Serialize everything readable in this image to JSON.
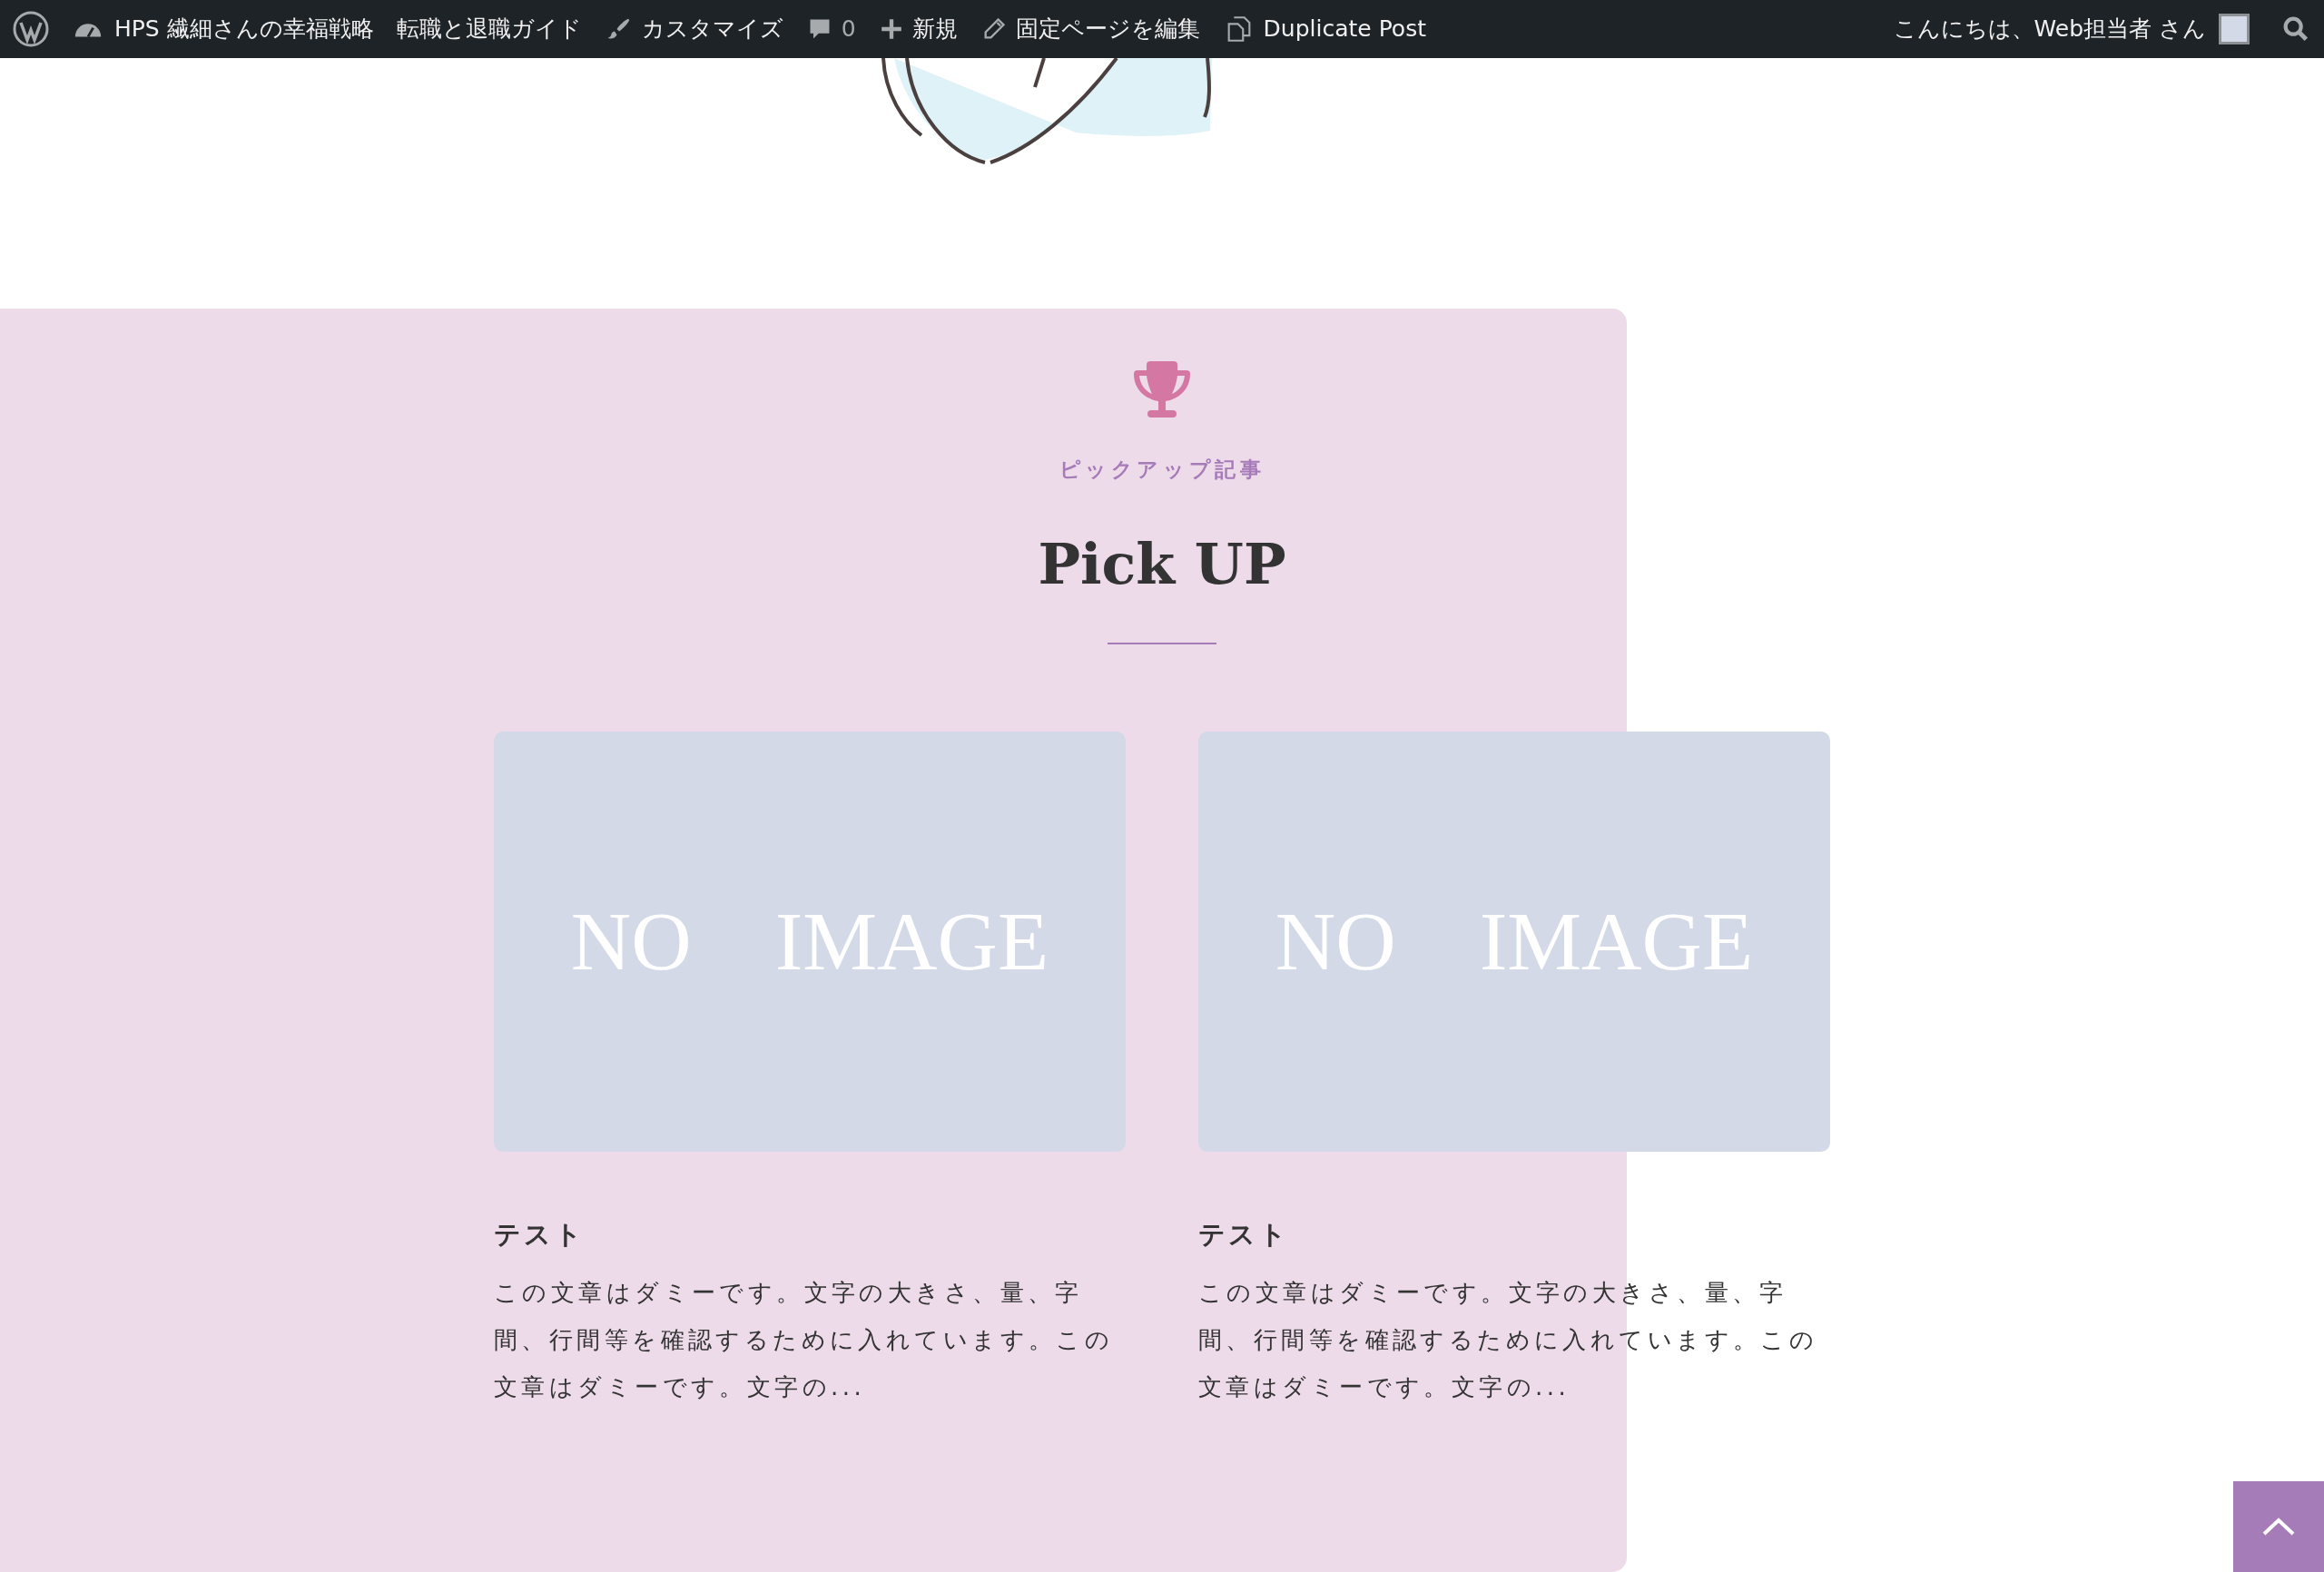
{
  "admin_bar": {
    "site_name": "HPS 繊細さんの幸福戦略　転職と退職ガイド",
    "items": [
      {
        "kind": "customize",
        "label": "カスタマイズ"
      },
      {
        "kind": "comments",
        "label": "0"
      },
      {
        "kind": "new",
        "label": "新規"
      },
      {
        "kind": "edit",
        "label": "固定ページを編集"
      },
      {
        "kind": "duplicate",
        "label": "Duplicate Post"
      }
    ],
    "greeting": "こんにちは、Web担当者 さん"
  },
  "pickup": {
    "subtitle": "ピックアップ記事",
    "title": "Pick UP",
    "posts": [
      {
        "image_label": "NO　IMAGE",
        "title": "テスト",
        "excerpt": "この文章はダミーです。文字の大きさ、量、字間、行間等を確認するために入れています。この文章はダミーです。文字の..."
      },
      {
        "image_label": "NO　IMAGE",
        "title": "テスト",
        "excerpt": "この文章はダミーです。文字の大きさ、量、字間、行間等を確認するために入れています。この文章はダミーです。文字の..."
      }
    ]
  }
}
